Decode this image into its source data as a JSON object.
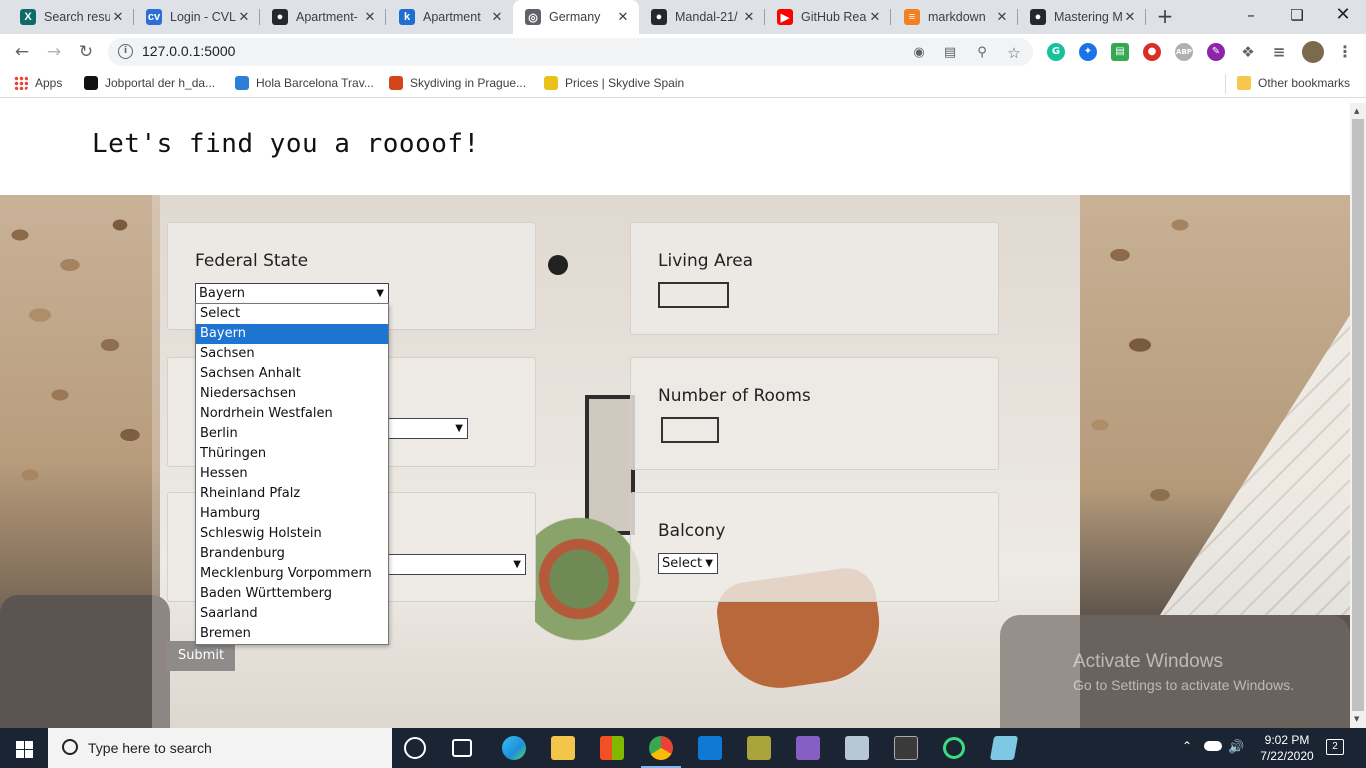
{
  "browser": {
    "tabs": [
      {
        "title": "Search resu",
        "icon": "xing-icon",
        "color": "#0f6b68"
      },
      {
        "title": "Login - CVL",
        "icon": "cv-icon",
        "color": "#2b6fd6"
      },
      {
        "title": "Apartment-",
        "icon": "github-icon",
        "color": "#24292e"
      },
      {
        "title": "Apartment",
        "icon": "k-icon",
        "color": "#1f6fd1"
      },
      {
        "title": "Germany",
        "icon": "globe-icon",
        "color": "#5f6368",
        "active": true
      },
      {
        "title": "Mandal-21/",
        "icon": "github-icon",
        "color": "#24292e"
      },
      {
        "title": "GitHub Rea",
        "icon": "youtube-icon",
        "color": "#ff0000"
      },
      {
        "title": "markdown",
        "icon": "stackoverflow-icon",
        "color": "#f48024"
      },
      {
        "title": "Mastering M",
        "icon": "github-icon",
        "color": "#24292e"
      }
    ],
    "url": "127.0.0.1:5000"
  },
  "bookmarks": {
    "apps": "Apps",
    "items": [
      {
        "label": "Jobportal der h_da...",
        "color": "#111111"
      },
      {
        "label": "Hola Barcelona Trav...",
        "color": "#2d7ed8"
      },
      {
        "label": "Skydiving in Prague...",
        "color": "#d4451c"
      },
      {
        "label": "Prices | Skydive Spain",
        "color": "#e8c21a"
      }
    ],
    "other": "Other bookmarks"
  },
  "page": {
    "heading": "Let's find you a roooof!",
    "federal_state": {
      "label": "Federal State",
      "selected": "Bayern",
      "options": [
        "Select",
        "Bayern",
        "Sachsen",
        "Sachsen Anhalt",
        "Niedersachsen",
        "Nordrhein Westfalen",
        "Berlin",
        "Thüringen",
        "Hessen",
        "Rheinland Pfalz",
        "Hamburg",
        "Schleswig Holstein",
        "Brandenburg",
        "Mecklenburg Vorpommern",
        "Baden Württemberg",
        "Saarland",
        "Bremen"
      ]
    },
    "living_area": {
      "label": "Living Area",
      "value": ""
    },
    "number_of_rooms": {
      "label": "Number of Rooms",
      "value": ""
    },
    "balcony": {
      "label": "Balcony",
      "selected": "Select"
    },
    "submit": "Submit"
  },
  "watermark": {
    "line1": "Activate Windows",
    "line2": "Go to Settings to activate Windows."
  },
  "taskbar": {
    "search_placeholder": "Type here to search",
    "time": "9:02 PM",
    "date": "7/22/2020",
    "notifications": "2"
  }
}
